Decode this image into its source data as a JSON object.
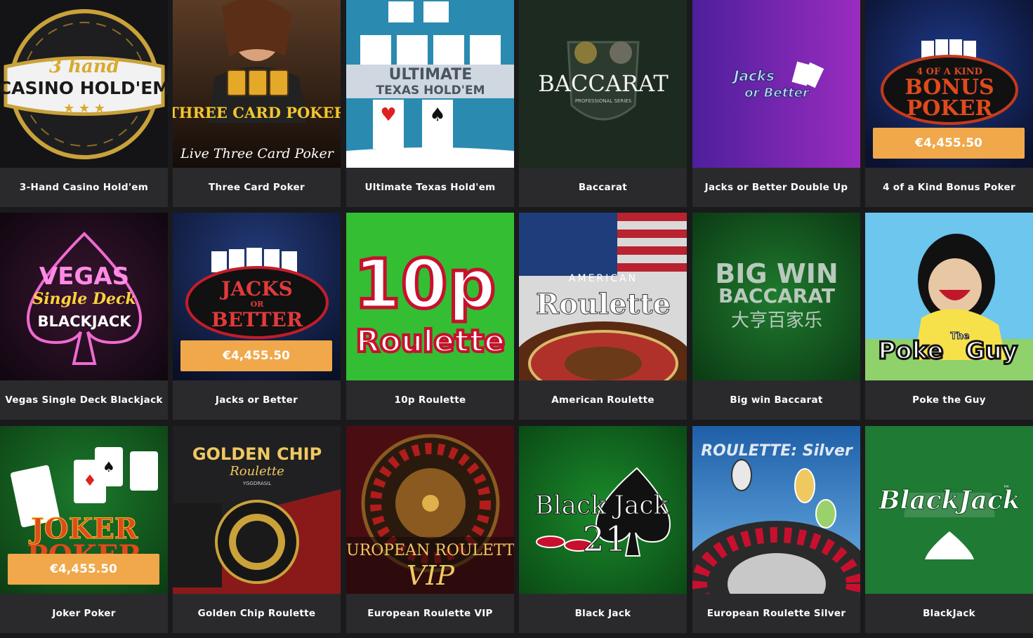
{
  "jackpot_value": "€4,455.50",
  "colors": {
    "page_bg": "#1a1a1c",
    "tile_bg": "#2a2a2d",
    "jackpot_bg": "#f0a84b",
    "caption_text": "#ffffff"
  },
  "games": [
    {
      "title": "3-Hand Casino Hold'em",
      "art": {
        "line1": "3 hand",
        "line2": "CASINO HOLD'EM"
      }
    },
    {
      "title": "Three Card Poker",
      "art": {
        "line1": "THREE CARD POKER",
        "line2": "Live Three Card Poker"
      }
    },
    {
      "title": "Ultimate Texas Hold'em",
      "art": {
        "line1": "ULTIMATE",
        "line2": "TEXAS HOLD'EM"
      }
    },
    {
      "title": "Baccarat",
      "art": {
        "line1": "BACCARAT",
        "line2": "PROFESSIONAL SERIES"
      }
    },
    {
      "title": "Jacks or Better Double Up",
      "art": {
        "line1": "Jacks",
        "line2": "or Better"
      }
    },
    {
      "title": "4 of a Kind Bonus Poker",
      "art": {
        "line1": "4 OF A KIND",
        "line2": "BONUS",
        "line3": "POKER"
      },
      "jackpot": true
    },
    {
      "title": "Vegas Single Deck Blackjack",
      "art": {
        "line1": "VEGAS",
        "line2": "Single Deck",
        "line3": "BLACKJACK"
      }
    },
    {
      "title": "Jacks or Better",
      "art": {
        "line1": "JACKS",
        "line2": "OR",
        "line3": "BETTER"
      },
      "jackpot": true
    },
    {
      "title": "10p Roulette",
      "art": {
        "line1": "10p",
        "line2": "Roulette"
      }
    },
    {
      "title": "American Roulette",
      "art": {
        "line1": "AMERICAN",
        "line2": "Roulette"
      }
    },
    {
      "title": "Big win Baccarat",
      "art": {
        "line1": "BIG WIN",
        "line2": "BACCARAT",
        "line3": "大亨百家乐"
      }
    },
    {
      "title": "Poke the Guy",
      "art": {
        "line1": "Poke",
        "line2": "The",
        "line3": "Guy"
      }
    },
    {
      "title": "Joker Poker",
      "art": {
        "line1": "JOKER",
        "line2": "POKER"
      },
      "jackpot": true
    },
    {
      "title": "Golden Chip Roulette",
      "art": {
        "line1": "GOLDEN CHIP",
        "line2": "Roulette",
        "line3": "YGGDRASIL"
      }
    },
    {
      "title": "European Roulette VIP",
      "art": {
        "line1": "EUROPEAN ROULETTE",
        "line2": "VIP"
      }
    },
    {
      "title": "Black Jack",
      "art": {
        "line1": "Black Jack",
        "line2": "21"
      }
    },
    {
      "title": "European Roulette Silver",
      "art": {
        "line1": "ROULETTE: Silver"
      }
    },
    {
      "title": "BlackJack",
      "art": {
        "line1": "BlackJack",
        "line2": "™"
      }
    }
  ]
}
